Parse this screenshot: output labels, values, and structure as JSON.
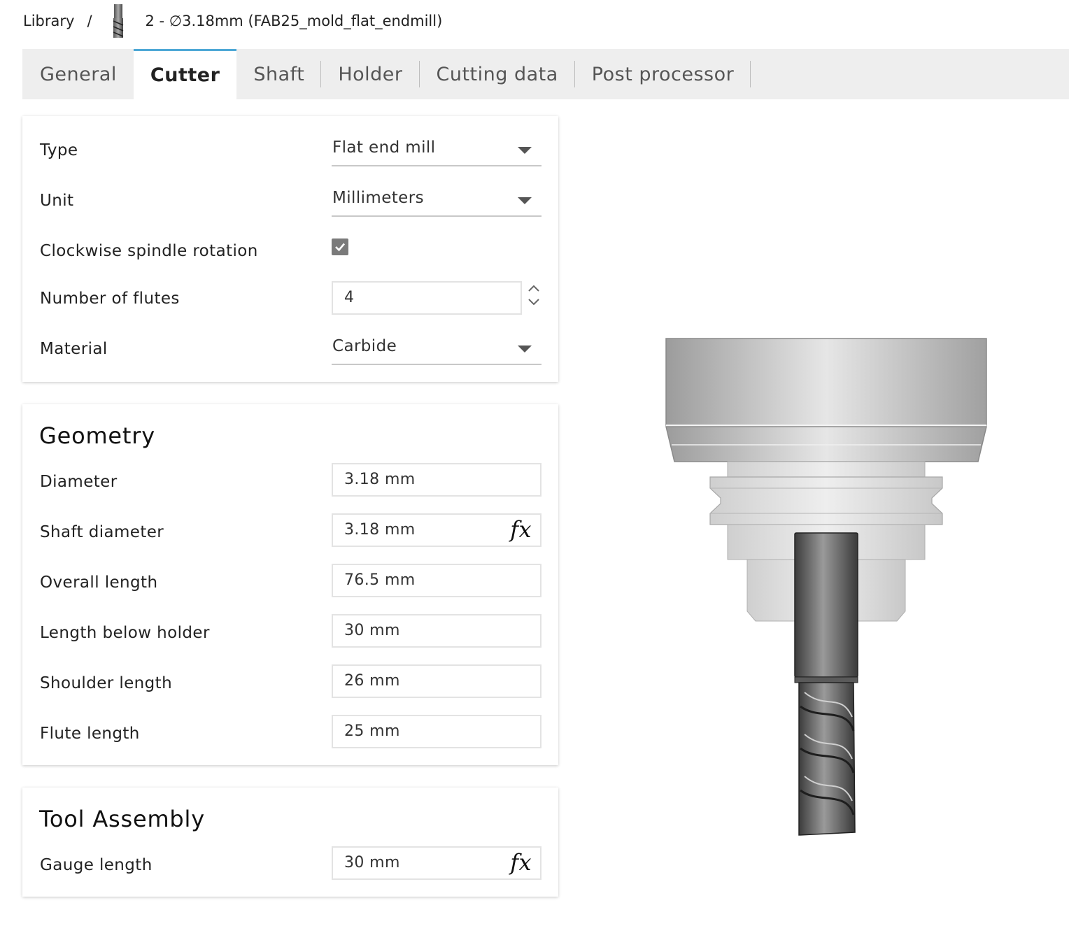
{
  "breadcrumb": {
    "library": "Library",
    "separator": "/",
    "tool_title": "2 - ∅3.18mm (FAB25_mold_flat_endmill)",
    "tool_icon": "endmill-icon"
  },
  "tabs": [
    {
      "label": "General"
    },
    {
      "label": "Cutter",
      "active": true
    },
    {
      "label": "Shaft"
    },
    {
      "label": "Holder"
    },
    {
      "label": "Cutting data"
    },
    {
      "label": "Post processor"
    }
  ],
  "cutter": {
    "type": {
      "label": "Type",
      "value": "Flat end mill"
    },
    "unit": {
      "label": "Unit",
      "value": "Millimeters"
    },
    "clockwise": {
      "label": "Clockwise spindle rotation",
      "checked": true
    },
    "flutes": {
      "label": "Number of flutes",
      "value": "4"
    },
    "material": {
      "label": "Material",
      "value": "Carbide"
    }
  },
  "geometry": {
    "title": "Geometry",
    "diameter": {
      "label": "Diameter",
      "value": "3.18 mm"
    },
    "shaft_diameter": {
      "label": "Shaft diameter",
      "value": "3.18 mm",
      "formula": "fx"
    },
    "overall_length": {
      "label": "Overall length",
      "value": "76.5 mm"
    },
    "length_below_holder": {
      "label": "Length below holder",
      "value": "30 mm"
    },
    "shoulder_length": {
      "label": "Shoulder length",
      "value": "26 mm"
    },
    "flute_length": {
      "label": "Flute length",
      "value": "25 mm"
    }
  },
  "assembly": {
    "title": "Tool Assembly",
    "gauge_length": {
      "label": "Gauge length",
      "value": "30 mm",
      "formula": "fx"
    }
  },
  "colors": {
    "active_tab_accent": "#4fa8d6",
    "tab_bar": "#eeeeee",
    "checkbox": "#7a7a7a"
  }
}
